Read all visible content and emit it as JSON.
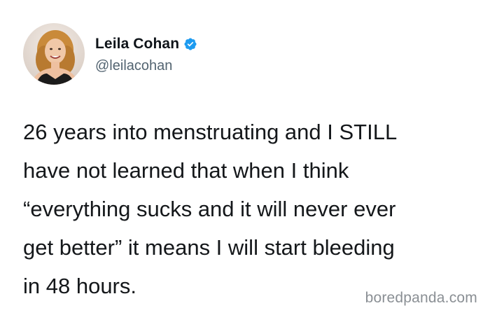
{
  "tweet": {
    "author": {
      "display_name": "Leila Cohan",
      "handle": "@leilacohan",
      "verified": true,
      "avatar_icon": "profile-photo",
      "verified_icon": "verified-badge-icon",
      "verified_color": "#1d9bf0"
    },
    "text_lines": [
      "26 years into menstruating and I STILL",
      "have not learned that when I think",
      "“everything sucks and it will never ever",
      "get better” it means I will start bleeding",
      "in 48 hours."
    ]
  },
  "watermark": {
    "text": "boredpanda.com"
  }
}
